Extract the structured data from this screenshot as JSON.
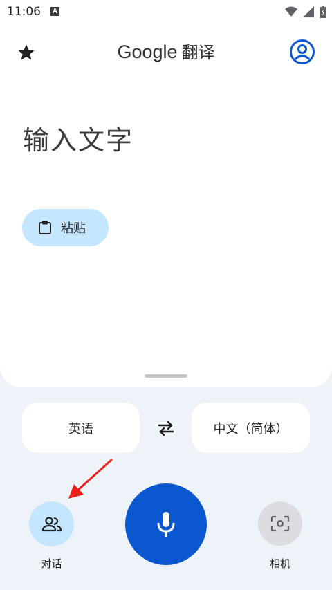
{
  "status_bar": {
    "time": "11:06",
    "notification_badge": "A",
    "icons": [
      "wifi-icon",
      "signal-icon",
      "battery-icon"
    ]
  },
  "header": {
    "logo_google": "Google",
    "logo_translate": "翻译",
    "icons": {
      "saved": "star-icon",
      "account": "account-circle-icon"
    }
  },
  "input": {
    "placeholder": "输入文字"
  },
  "paste": {
    "label": "粘贴",
    "icon": "clipboard-icon"
  },
  "languages": {
    "source": "英语",
    "target": "中文（简体）",
    "swap_icon": "swap-arrows-icon"
  },
  "actions": {
    "conversation_label": "对话",
    "camera_label": "相机",
    "icons": {
      "conversation": "people-icon",
      "mic": "mic-icon",
      "camera": "camera-lens-icon"
    }
  },
  "colors": {
    "accent_blue": "#0b57d0",
    "chip_blue": "#c4e7ff",
    "page_bg": "#eef2f9",
    "annotation_red": "#e8231b"
  }
}
